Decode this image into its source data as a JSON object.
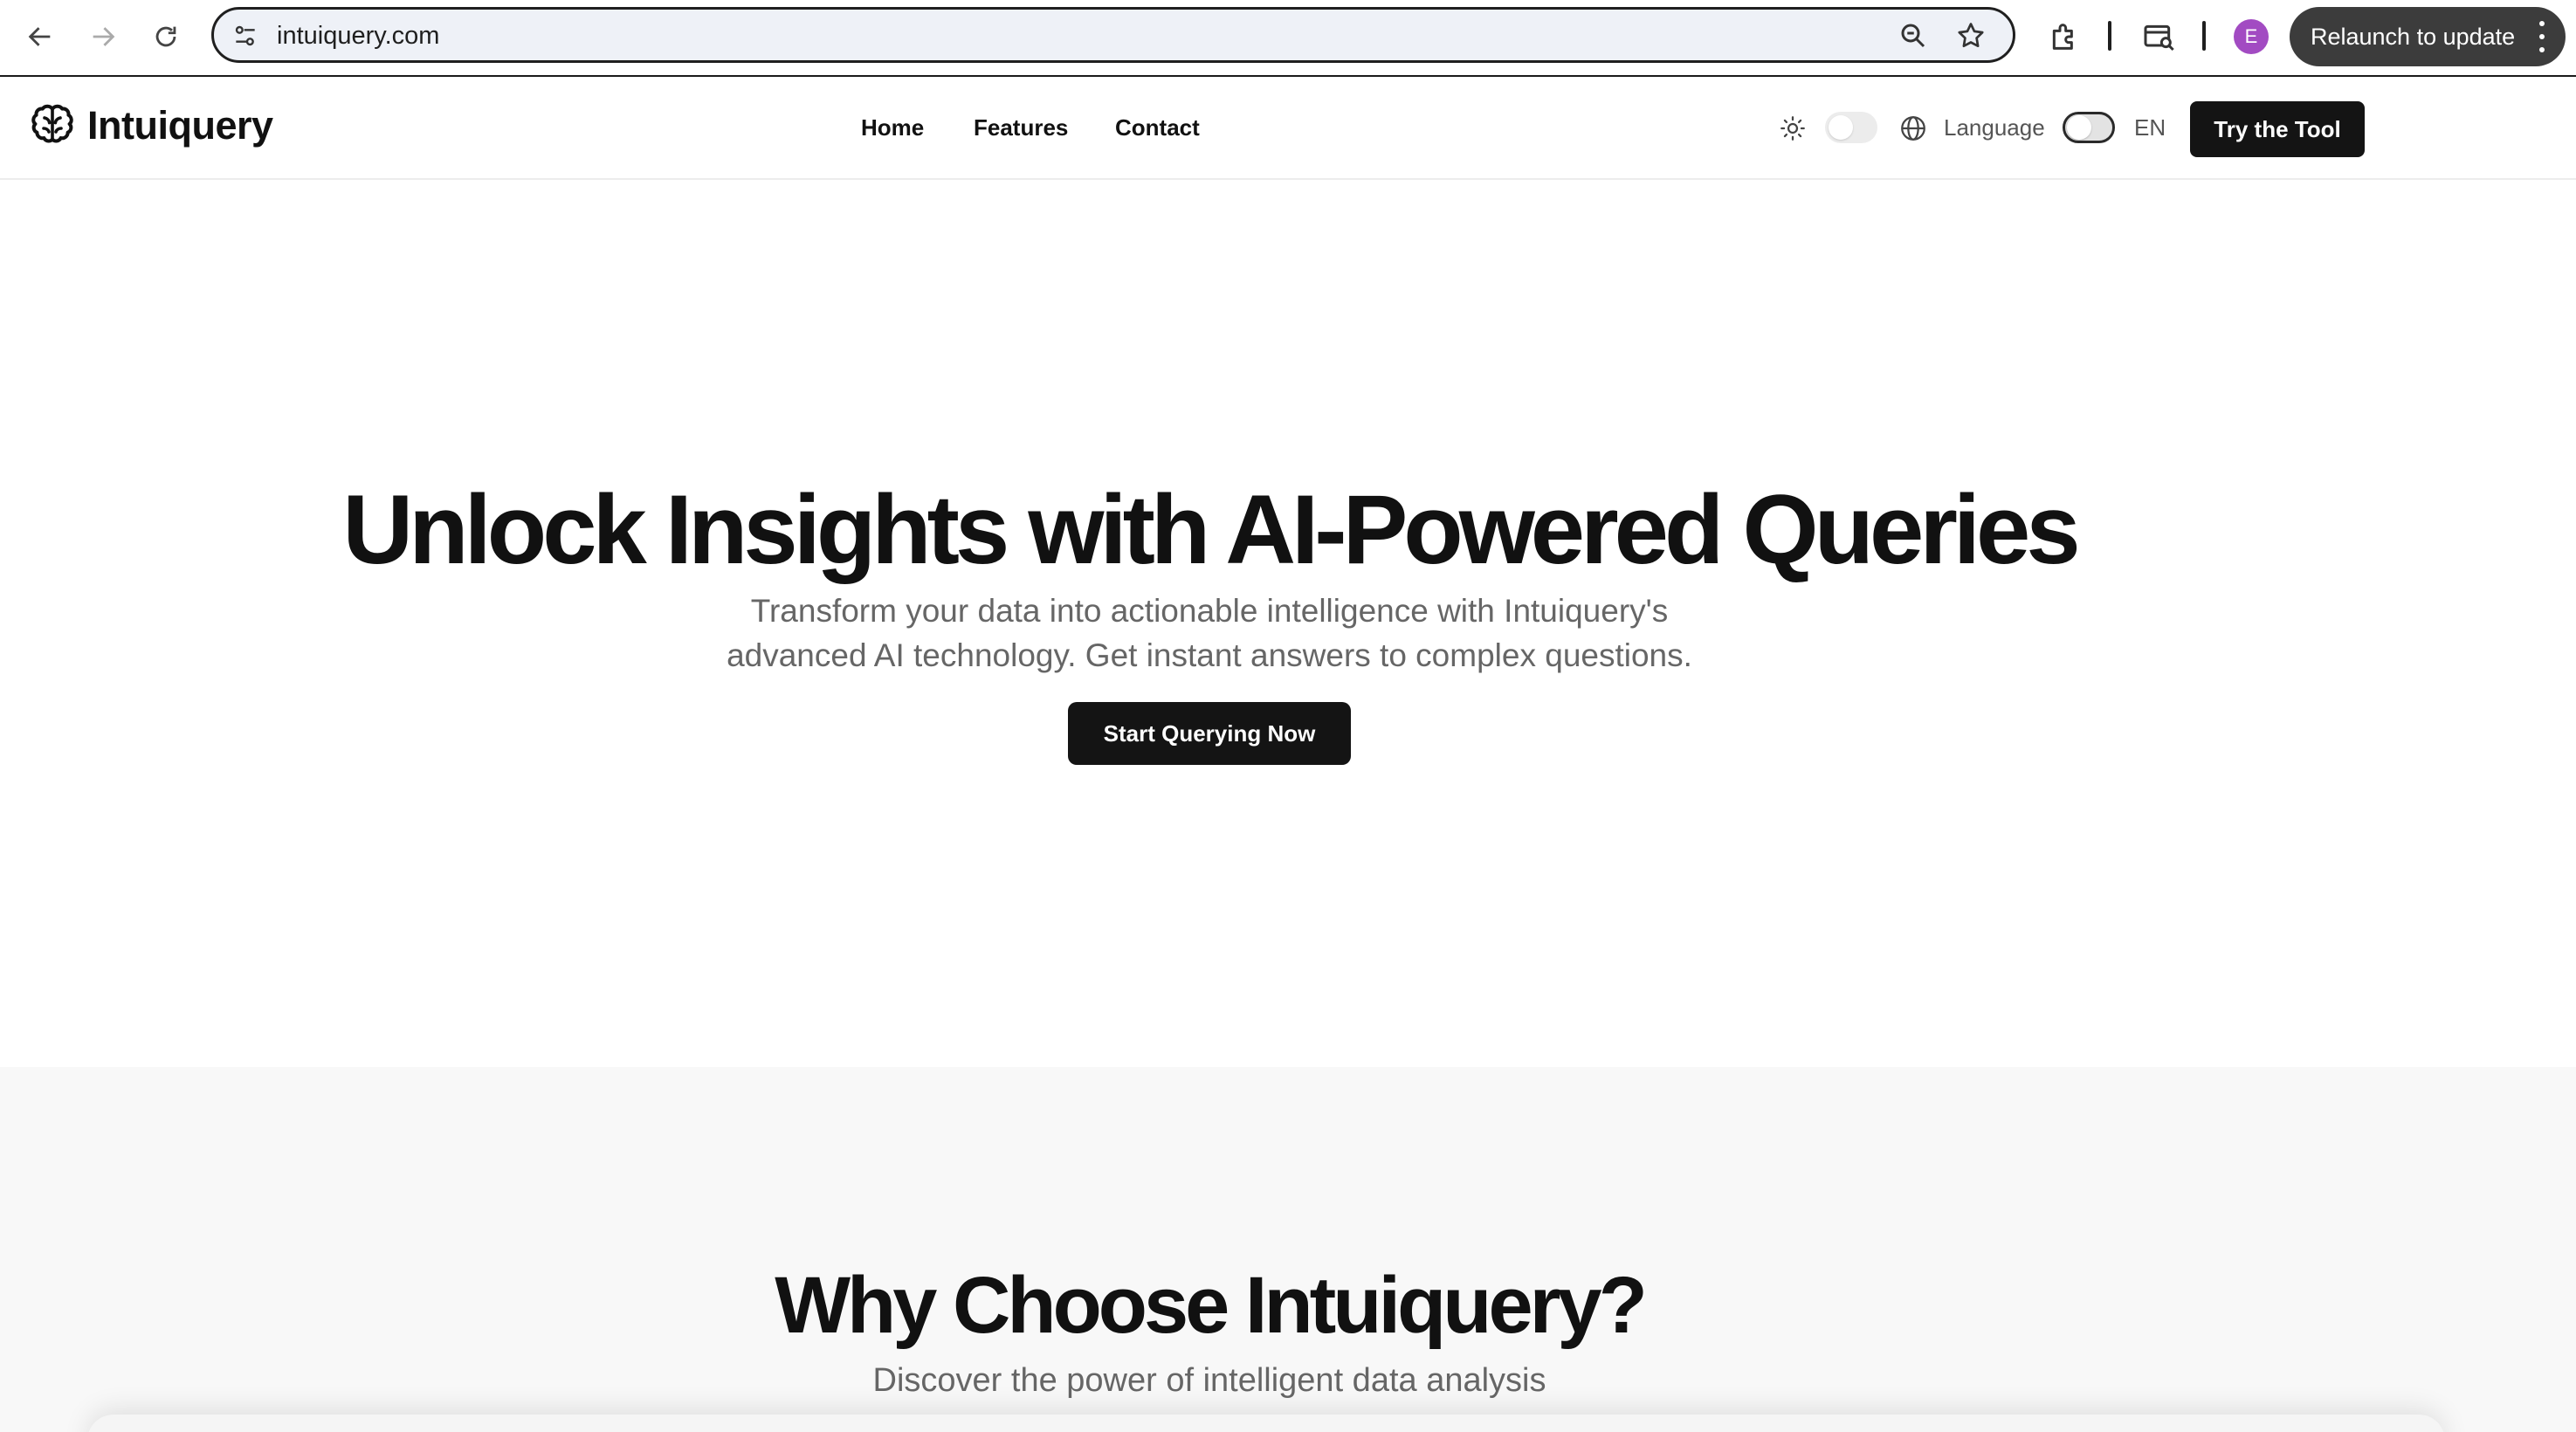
{
  "browser": {
    "url": "intuiquery.com",
    "profile_initial": "E",
    "relaunch_label": "Relaunch to update",
    "icons": [
      "back-arrow-icon",
      "forward-arrow-icon",
      "reload-icon",
      "site-settings-icon",
      "zoom-icon",
      "bookmark-star-icon",
      "extensions-icon",
      "tab-search-icon",
      "more-vert-icon"
    ],
    "profile_color": "#a24bc2"
  },
  "header": {
    "brand_name": "Intuiquery",
    "nav": [
      "Home",
      "Features",
      "Contact"
    ],
    "language_label": "Language",
    "language_code": "EN",
    "cta_label": "Try the Tool"
  },
  "hero": {
    "title": "Unlock Insights with AI-Powered Queries",
    "subtitle_line1": "Transform your data into actionable intelligence with Intuiquery's",
    "subtitle_line2": "advanced AI technology. Get instant answers to complex questions.",
    "cta_label": "Start Querying Now"
  },
  "features": {
    "title": "Why Choose Intuiquery?",
    "subtitle": "Discover the power of intelligent data analysis"
  },
  "colors": {
    "primary_button": "#141414",
    "text_primary": "#111111",
    "text_muted": "#666666",
    "section_alt_bg": "#f8f8f8"
  }
}
